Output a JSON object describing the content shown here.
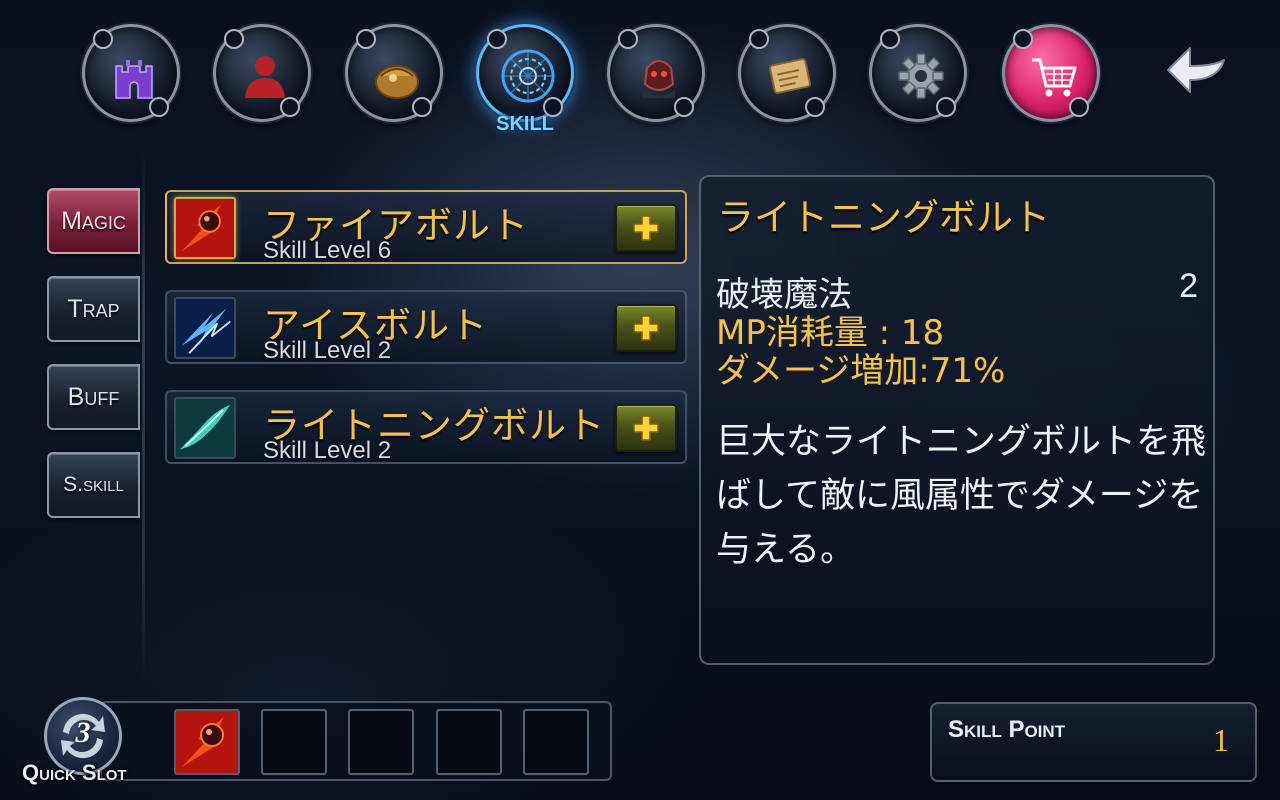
{
  "nav": {
    "active_label": "SKILL",
    "items": [
      {
        "icon": "castle-icon"
      },
      {
        "icon": "character-icon"
      },
      {
        "icon": "bag-icon"
      },
      {
        "icon": "magic-circle-icon",
        "label": "SKILL",
        "active": true
      },
      {
        "icon": "companion-icon"
      },
      {
        "icon": "scroll-icon"
      },
      {
        "icon": "gear-icon"
      },
      {
        "icon": "shopping-cart-icon"
      }
    ],
    "back_icon": "back-arrow-icon"
  },
  "tabs": [
    {
      "label": "Magic",
      "active": true
    },
    {
      "label": "Trap"
    },
    {
      "label": "Buff"
    },
    {
      "label": "S.skill"
    }
  ],
  "skills": [
    {
      "name": "ファイアボルト",
      "level": "Skill Level 6",
      "icon": "fire-bolt-icon",
      "selected": true
    },
    {
      "name": "アイスボルト",
      "level": "Skill Level 2",
      "icon": "ice-bolt-icon"
    },
    {
      "name": "ライトニングボルト",
      "level": "Skill Level 2",
      "icon": "lightning-bolt-icon"
    }
  ],
  "detail": {
    "title": "ライトニングボルト",
    "category": "破壊魔法",
    "level": "2",
    "mp": "MP消耗量 : 18",
    "damage": "ダメージ増加:71%",
    "description": "巨大なライトニングボルトを飛ばして敵に風属性でダメージを与える。"
  },
  "quickslot": {
    "label": "Quick Slot",
    "number": "3",
    "slots": [
      {
        "icon": "fire-bolt-icon"
      },
      {
        "icon": ""
      },
      {
        "icon": ""
      },
      {
        "icon": ""
      },
      {
        "icon": ""
      }
    ]
  },
  "skill_point": {
    "label": "Skill Point",
    "value": "1"
  },
  "colors": {
    "gold_text": "#f4c24c",
    "active_tab": "#7a2037",
    "active_nav_glow": "#5ab8ff",
    "plus_button": "#49521a"
  }
}
